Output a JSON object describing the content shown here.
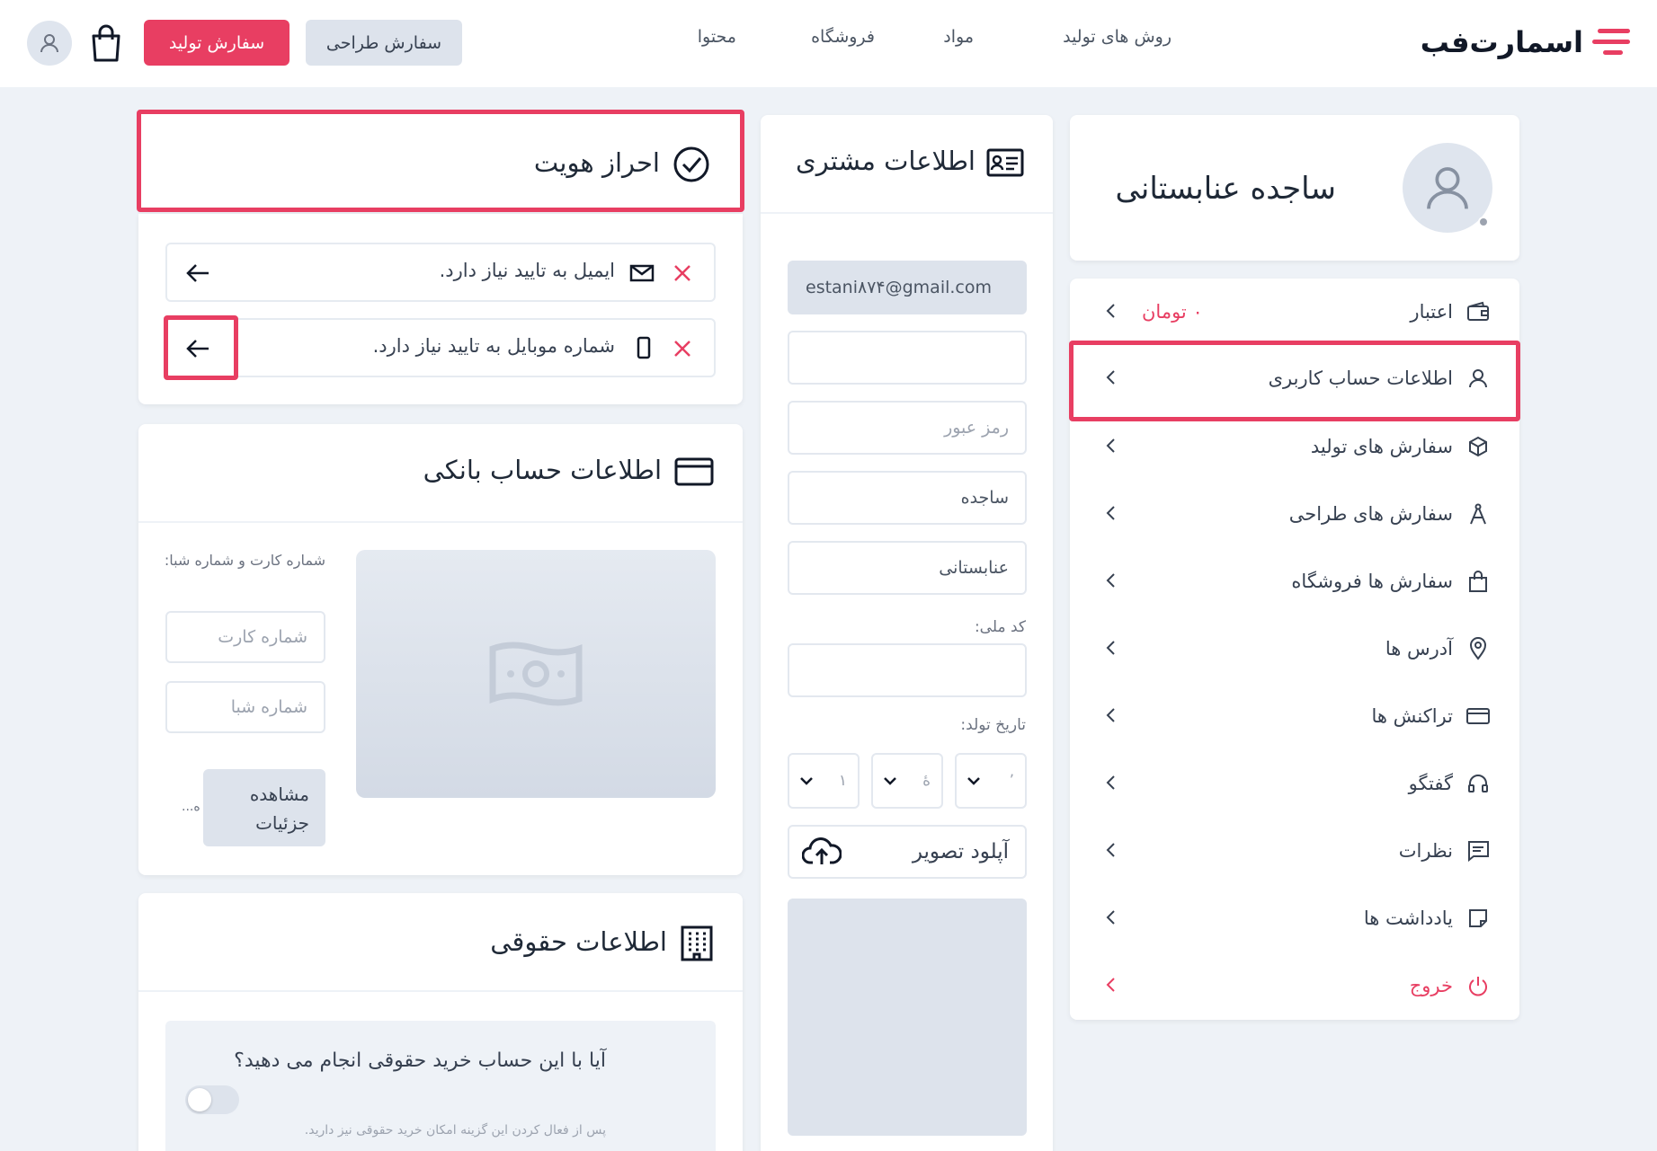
{
  "header": {
    "logo_text": "اسمارت‌فب",
    "nav": [
      "روش های تولید",
      "مواد",
      "فروشگاه",
      "محتوا"
    ],
    "design_order_label": "سفارش طراحی",
    "production_order_label": "سفارش تولید"
  },
  "profile": {
    "name": "ساجده عنابستانی"
  },
  "menu": {
    "items": [
      {
        "label": "اعتبار",
        "extra": "۰ تومان",
        "icon": "wallet-icon"
      },
      {
        "label": "اطلاعات حساب کاربری",
        "icon": "user-icon"
      },
      {
        "label": "سفارش های تولید",
        "icon": "box-icon"
      },
      {
        "label": "سفارش های طراحی",
        "icon": "compass-icon"
      },
      {
        "label": "سفارش ها فروشگاه",
        "icon": "bag-icon"
      },
      {
        "label": "آدرس ها",
        "icon": "location-icon"
      },
      {
        "label": "تراکنش ها",
        "icon": "card-icon"
      },
      {
        "label": "گفتگو",
        "icon": "headset-icon"
      },
      {
        "label": "نظرات",
        "icon": "comment-icon"
      },
      {
        "label": "یادداشت ها",
        "icon": "note-icon"
      },
      {
        "label": "خروج",
        "icon": "power-icon"
      }
    ]
  },
  "customer": {
    "title": "اطلاعات مشتری",
    "email": "estani۸۷۴@gmail.com",
    "mobile": "",
    "password_placeholder": "رمز عبور",
    "first_name": "ساجده",
    "last_name": "عنابستانی",
    "national_code_label": "کد ملی:",
    "birth_date_label": "تاریخ تولد:",
    "birth_selects": [
      "۱",
      "ۀ",
      "٬"
    ],
    "upload_label": "آپلود تصویر"
  },
  "identity": {
    "title": "احراز هویت",
    "email_notice": "ایمیل به تایید نیاز دارد.",
    "mobile_notice": "شماره موبایل به تایید نیاز دارد."
  },
  "bank": {
    "title": "اطلاعات حساب بانکی",
    "hint": "شماره کارت و شماره شبا:",
    "card_placeholder": "شماره کارت",
    "sheba_placeholder": "شماره شبا",
    "details_button": "مشاهده جزئیات",
    "ellipsis": "...ه"
  },
  "legal": {
    "title": "اطلاعات حقوقی",
    "question": "آیا با این حساب خرید حقوقی انجام می دهید؟",
    "hint": "پس از فعال کردن این گزینه امکان خرید حقوقی نیز دارید."
  },
  "colors": {
    "accent": "#e83e62",
    "muted": "#dde3ec"
  }
}
